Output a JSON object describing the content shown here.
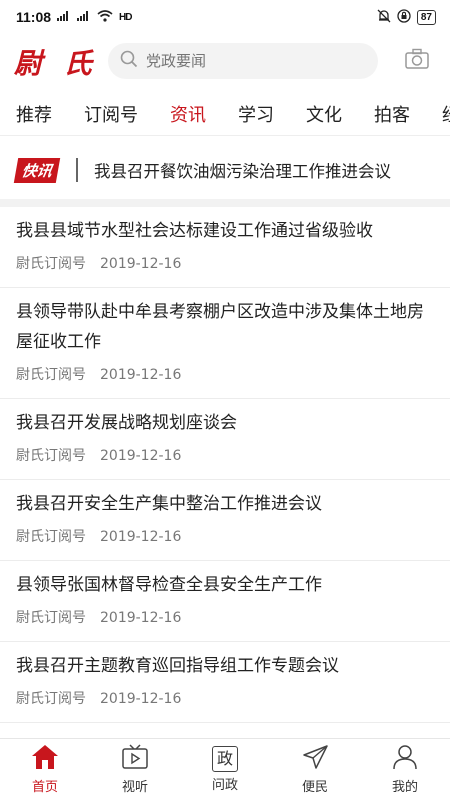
{
  "status": {
    "time": "11:08",
    "signal1": "5G",
    "signal2": "4G",
    "network": "HD",
    "battery": "87"
  },
  "header": {
    "logo": "尉 氏",
    "search_placeholder": "党政要闻"
  },
  "tabs": [
    "推荐",
    "订阅号",
    "资讯",
    "学习",
    "文化",
    "拍客",
    "经济"
  ],
  "flash": {
    "badge": "快讯",
    "text": "我县召开餐饮油烟污染治理工作推进会议"
  },
  "articles": [
    {
      "title": "我县县域节水型社会达标建设工作通过省级验收",
      "source": "尉氏订阅号",
      "date": "2019-12-16"
    },
    {
      "title": "县领导带队赴中牟县考察棚户区改造中涉及集体土地房屋征收工作",
      "source": "尉氏订阅号",
      "date": "2019-12-16"
    },
    {
      "title": "我县召开发展战略规划座谈会",
      "source": "尉氏订阅号",
      "date": "2019-12-16"
    },
    {
      "title": "我县召开安全生产集中整治工作推进会议",
      "source": "尉氏订阅号",
      "date": "2019-12-16"
    },
    {
      "title": "县领导张国林督导检查全县安全生产工作",
      "source": "尉氏订阅号",
      "date": "2019-12-16"
    },
    {
      "title": "我县召开主题教育巡回指导组工作专题会议",
      "source": "尉氏订阅号",
      "date": "2019-12-16"
    }
  ],
  "bottom_nav": [
    {
      "label": "首页",
      "icon": "home-icon"
    },
    {
      "label": "视听",
      "icon": "tv-icon"
    },
    {
      "label": "问政",
      "icon": "zheng-icon",
      "glyph": "政"
    },
    {
      "label": "便民",
      "icon": "send-icon"
    },
    {
      "label": "我的",
      "icon": "person-icon"
    }
  ],
  "colors": {
    "accent": "#c8161d"
  }
}
